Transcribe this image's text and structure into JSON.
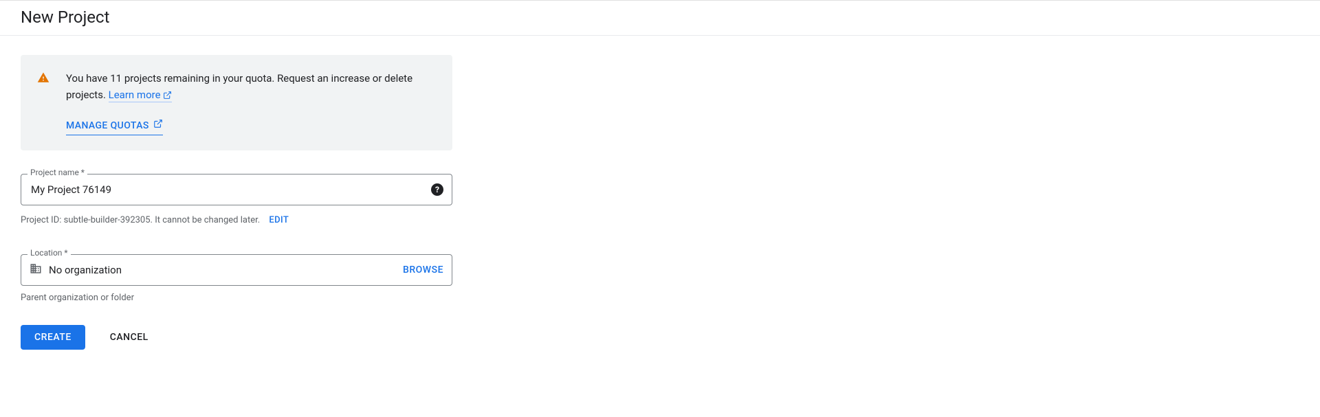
{
  "header": {
    "title": "New Project"
  },
  "notice": {
    "text_before_link": "You have 11 projects remaining in your quota. Request an increase or delete projects. ",
    "learn_more_label": "Learn more",
    "manage_quotas_label": "MANAGE QUOTAS"
  },
  "project_name": {
    "label": "Project name *",
    "value": "My Project 76149"
  },
  "project_id": {
    "prefix": "Project ID: subtle-builder-392305. It cannot be changed later.",
    "edit_label": "EDIT"
  },
  "location": {
    "label": "Location *",
    "value": "No organization",
    "browse_label": "BROWSE",
    "hint": "Parent organization or folder"
  },
  "buttons": {
    "create": "CREATE",
    "cancel": "CANCEL"
  }
}
